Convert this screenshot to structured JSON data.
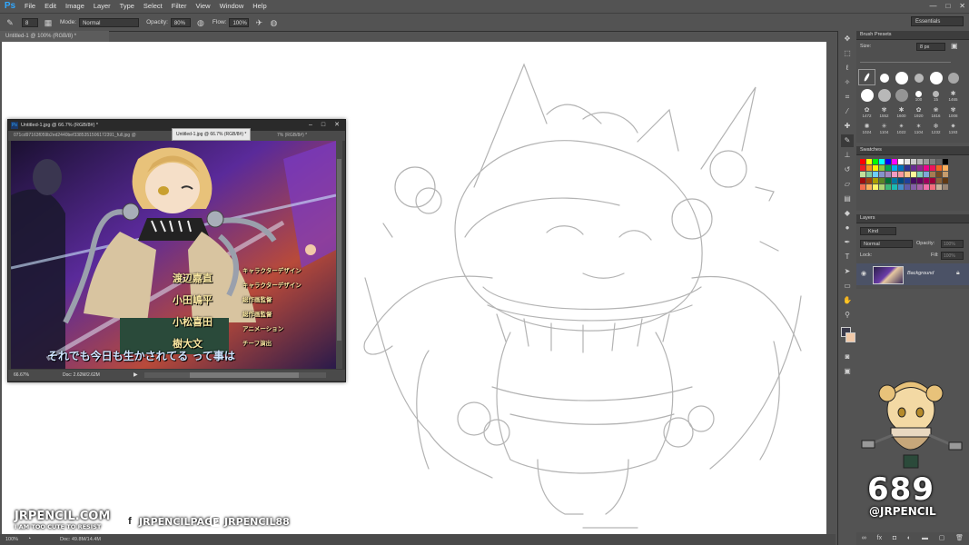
{
  "app": {
    "logo": "Ps"
  },
  "menu": [
    "File",
    "Edit",
    "Image",
    "Layer",
    "Type",
    "Select",
    "Filter",
    "View",
    "Window",
    "Help"
  ],
  "window_controls": [
    "—",
    "□",
    "✕"
  ],
  "options": {
    "mode_label": "Mode:",
    "mode_value": "Normal",
    "opacity_label": "Opacity:",
    "opacity_value": "80%",
    "flow_label": "Flow:",
    "flow_value": "100%",
    "brush_size": "8",
    "workspace": "Essentials"
  },
  "document": {
    "tab": "Untitled-1 @ 100% (RGB/8) *",
    "zoom": "100%",
    "doc_info": "Doc: 49.8M/14.4M"
  },
  "photo_window": {
    "title": "Untitled-1.jpg @ 66.7% (RGB/8#) *",
    "tab_1": "071cd97163f059b2ed2440bef3385351506172391_full.jpg @",
    "tab_2": "Untitled-1.jpg @ 66.7% (RGB/8#) *",
    "tab_3": "7% (RGB/8#) *",
    "zoom": "66.67%",
    "doc_info": "Doc: 2.62M/2.62M",
    "subtitle": "それでも今日も生かされてる って事は",
    "credits_left": [
      "渡辺嘉直",
      "小田嶋平",
      "小松喜田",
      "樹大文"
    ],
    "credits_right": [
      "キャラクターデザイン",
      "キャラクターデザイン",
      "総作画監督",
      "総作画監督",
      "アニメーション",
      "チーフ演出"
    ]
  },
  "brush_presets": {
    "title": "Brush Presets",
    "size_label": "Size:",
    "size_value": "8 px",
    "rows": [
      [
        "",
        "",
        "",
        "",
        "",
        "1465"
      ],
      [
        "",
        "",
        "",
        "100",
        "15",
        "1465"
      ],
      [
        "1472",
        "1552",
        "1600",
        "1920",
        "1816",
        "1008"
      ],
      [
        "1024",
        "1104",
        "1022",
        "1104",
        "1232",
        "1193"
      ]
    ]
  },
  "swatches": {
    "title": "Swatches",
    "colors": [
      "#ff0000",
      "#ffff00",
      "#00ff00",
      "#00ffff",
      "#0000ff",
      "#ff00ff",
      "#ffffff",
      "#e6e6e6",
      "#cccccc",
      "#b3b3b3",
      "#999999",
      "#808080",
      "#666666",
      "#000000",
      "#ed1c24",
      "#f7941d",
      "#fff200",
      "#8dc63f",
      "#00a651",
      "#00aeef",
      "#0072bc",
      "#2e3192",
      "#662d91",
      "#92278f",
      "#ec008c",
      "#ed145b",
      "#f26522",
      "#fbaf5d",
      "#c4df9b",
      "#82ca9c",
      "#6dcff6",
      "#8493ca",
      "#a186be",
      "#f49ac2",
      "#f6989d",
      "#fdc689",
      "#fff799",
      "#7dd0b6",
      "#7da7d9",
      "#a67c52",
      "#754c24",
      "#c69c6d",
      "#9e0b0f",
      "#a0410d",
      "#aba000",
      "#598527",
      "#007236",
      "#0076a3",
      "#004a80",
      "#21409a",
      "#440e62",
      "#630460",
      "#9e005d",
      "#9e0039",
      "#8c6239",
      "#603913",
      "#f26c4f",
      "#fbaf5d",
      "#fff568",
      "#acd373",
      "#3cb878",
      "#1cbbb4",
      "#448ccb",
      "#605ca8",
      "#855fa8",
      "#a864a8",
      "#f06eaa",
      "#f26d7d",
      "#c7b299",
      "#998675"
    ]
  },
  "layers": {
    "title": "Layers",
    "filter": "Kind",
    "blend": "Normal",
    "opacity_label": "Opacity:",
    "opacity_value": "100%",
    "lock_label": "Lock:",
    "fill_label": "Fill:",
    "fill_value": "100%",
    "layer_name": "Background"
  },
  "watermarks": {
    "site": "JRPENCIL.COM",
    "tagline": "I AM TOO CUTE TO RESIST",
    "facebook": "JRPENCILPAGE",
    "instagram": "JRPENCIL88",
    "number": "689",
    "handle": "@JRPENCIL"
  }
}
